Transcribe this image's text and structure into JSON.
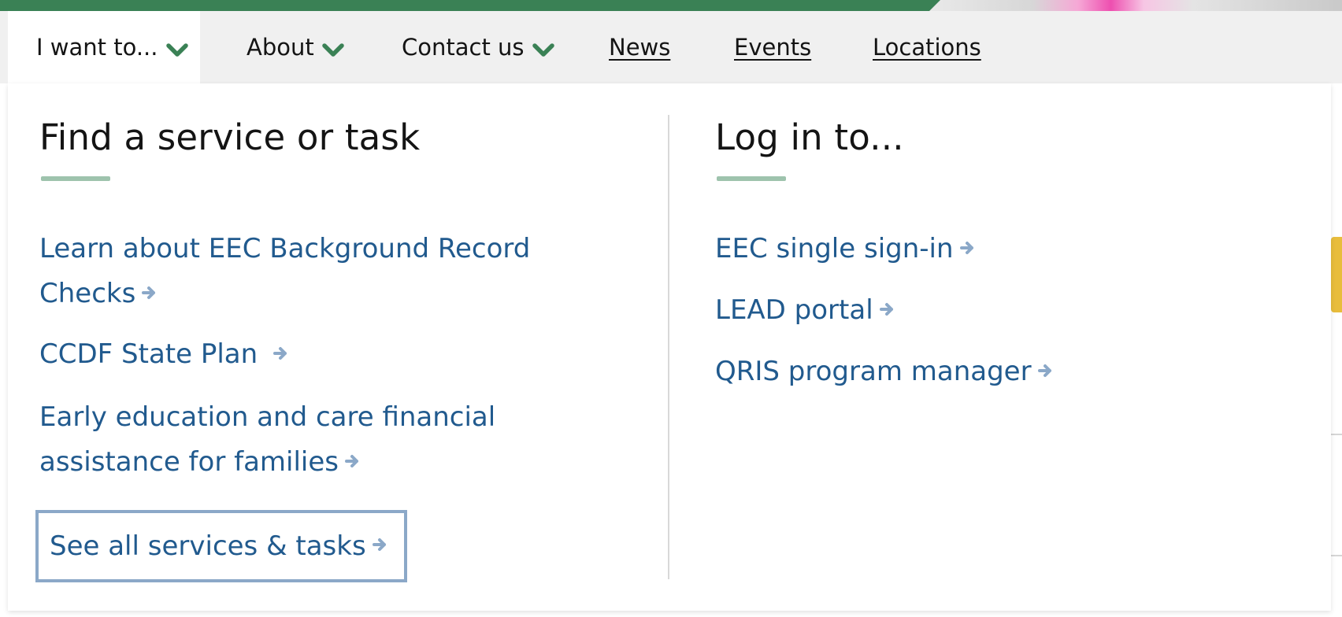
{
  "nav": {
    "items": [
      {
        "label": "I want to...",
        "has_caret": true,
        "active": true
      },
      {
        "label": "About",
        "has_caret": true,
        "active": false
      },
      {
        "label": "Contact us",
        "has_caret": true,
        "active": false
      },
      {
        "label": "News",
        "has_caret": false,
        "active": false
      },
      {
        "label": "Events",
        "has_caret": false,
        "active": false
      },
      {
        "label": "Locations",
        "has_caret": false,
        "active": false
      }
    ]
  },
  "dropdown": {
    "services": {
      "heading": "Find a service or task",
      "links": [
        {
          "line1": "Learn about EEC Background Record",
          "line2": "Checks"
        },
        {
          "line1": "CCDF State Plan",
          "line2": ""
        },
        {
          "line1": "Early education and care financial",
          "line2": "assistance for families"
        }
      ],
      "see_all_label": "See all services & tasks"
    },
    "login": {
      "heading": "Log in to...",
      "links": [
        {
          "label": "EEC single sign-in"
        },
        {
          "label": "LEAD portal"
        },
        {
          "label": "QRIS program manager"
        }
      ]
    }
  },
  "icons": {
    "caret": "chevron-down-icon",
    "arrow": "arrow-right-icon"
  },
  "colors": {
    "brand_green": "#3a8155",
    "link_blue": "#215a8e",
    "arrow_blue": "#8ba8c8",
    "heading_underline": "#9ec3ad",
    "accent_yellow": "#e8bd3c"
  }
}
